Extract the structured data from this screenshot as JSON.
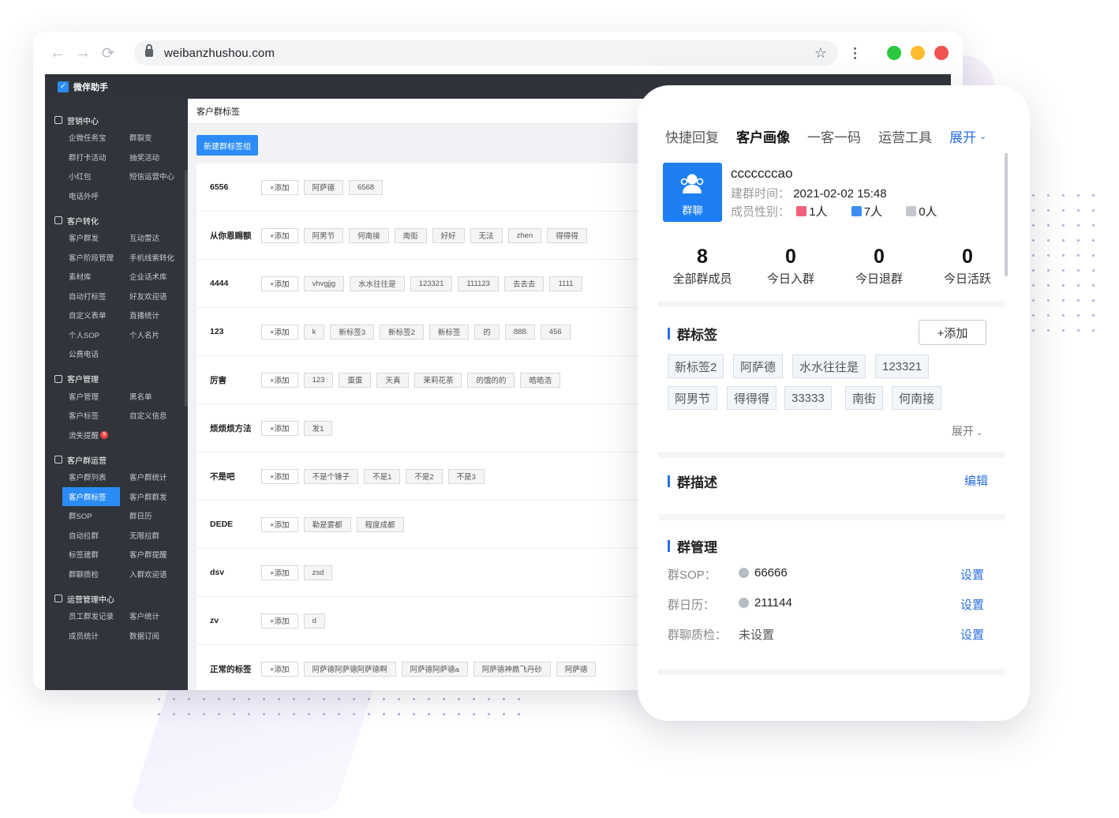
{
  "browser": {
    "url": "weibanzhushou.com",
    "traffic_lights": [
      "#2bc840",
      "#fdbc2e",
      "#ef5350"
    ]
  },
  "app": {
    "title": "微伴助手",
    "accent": "#2b8cf6"
  },
  "sidebar": {
    "sections": [
      {
        "title": "营销中心",
        "items": [
          "企微任务宝",
          "群裂变",
          "群打卡活动",
          "抽奖活动",
          "小红包",
          "短信运营中心",
          "电话外呼"
        ]
      },
      {
        "title": "客户转化",
        "items": [
          "客户群发",
          "互动雷达",
          "客户阶段管理",
          "手机线索转化",
          "素材库",
          "企业话术库",
          "自动打标签",
          "好友欢迎语",
          "自定义表单",
          "直播统计",
          "个人SOP",
          "个人名片",
          "公费电话"
        ]
      },
      {
        "title": "客户管理",
        "items": [
          "客户管理",
          "黑名单",
          "客户标签",
          "自定义信息",
          "流失提醒"
        ],
        "badge": "9"
      },
      {
        "title": "客户群运营",
        "items": [
          "客户群列表",
          "客户群统计",
          "客户群标签",
          "客户群群发",
          "群SOP",
          "群日历",
          "自动拉群",
          "无限拉群",
          "标签建群",
          "客户群提醒",
          "群聊质检",
          "入群欢迎语"
        ],
        "active": "客户群标签"
      },
      {
        "title": "运营管理中心",
        "items": [
          "员工群发记录",
          "客户统计",
          "成员统计",
          "数据订阅"
        ]
      }
    ]
  },
  "content": {
    "title": "客户群标签",
    "new_button": "新建群标签组",
    "add_label": "+添加",
    "rows": [
      {
        "name": "6556",
        "tags": [
          "阿萨德",
          "6568"
        ]
      },
      {
        "name": "从你恩赐额",
        "tags": [
          "阿男节",
          "何南接",
          "南街",
          "好好",
          "无法",
          "zhen",
          "得得得"
        ]
      },
      {
        "name": "4444",
        "tags": [
          "vhvgjjg",
          "水水往往是",
          "123321",
          "111123",
          "去去去",
          "1111"
        ]
      },
      {
        "name": "123",
        "tags": [
          "k",
          "新标签3",
          "新标签2",
          "新标签",
          "的",
          "888",
          "456"
        ]
      },
      {
        "name": "厉害",
        "tags": [
          "123",
          "蛋蛋",
          "天真",
          "茉莉花茶",
          "的饿的的",
          "皓皓浩"
        ]
      },
      {
        "name": "烦烦烦方法",
        "tags": [
          "发1"
        ]
      },
      {
        "name": "不是吧",
        "tags": [
          "不是个锤子",
          "不是1",
          "不是2",
          "不是3"
        ]
      },
      {
        "name": "DEDE",
        "tags": [
          "勒是雾都",
          "程度成都"
        ]
      },
      {
        "name": "dsv",
        "tags": [
          "zsd"
        ]
      },
      {
        "name": "zv",
        "tags": [
          "d"
        ]
      },
      {
        "name": "正常的标签",
        "tags": [
          "阿萨德阿萨德阿萨德啊",
          "阿萨德阿萨德a",
          "阿萨德神鼎飞丹砂",
          "阿萨德"
        ]
      }
    ]
  },
  "panel": {
    "tabs": [
      "快捷回复",
      "客户画像",
      "一客一码",
      "运营工具"
    ],
    "active_tab": "客户画像",
    "expand": "展开",
    "group": {
      "avatar_label": "群聊",
      "name": "cccccccao",
      "created_key": "建群时间：",
      "created_value": "2021-02-02 15:48",
      "gender_key": "成员性别：",
      "female": "1人",
      "male": "7人",
      "unknown": "0人"
    },
    "stats": [
      {
        "value": "8",
        "label": "全部群成员"
      },
      {
        "value": "0",
        "label": "今日入群"
      },
      {
        "value": "0",
        "label": "今日退群"
      },
      {
        "value": "0",
        "label": "今日活跃"
      }
    ],
    "tags_title": "群标签",
    "tags_add": "+添加",
    "tags": [
      "新标签2",
      "阿萨德",
      "水水往往是",
      "123321",
      "阿男节",
      "得得得",
      "33333",
      "南街",
      "何南接"
    ],
    "tags_expand": "展开",
    "desc_title": "群描述",
    "desc_edit": "编辑",
    "manage_title": "群管理",
    "manage": [
      {
        "key": "群SOP：",
        "value": "66666",
        "action": "设置"
      },
      {
        "key": "群日历：",
        "value": "211144",
        "action": "设置"
      },
      {
        "key": "群聊质检：",
        "value": "未设置",
        "action": "设置"
      }
    ],
    "colors": {
      "accent": "#2b6fe0",
      "avatar": "#1d7ff2",
      "female": "#f0607a",
      "male": "#3d8ef0",
      "unknown": "#c4c7cc"
    }
  }
}
